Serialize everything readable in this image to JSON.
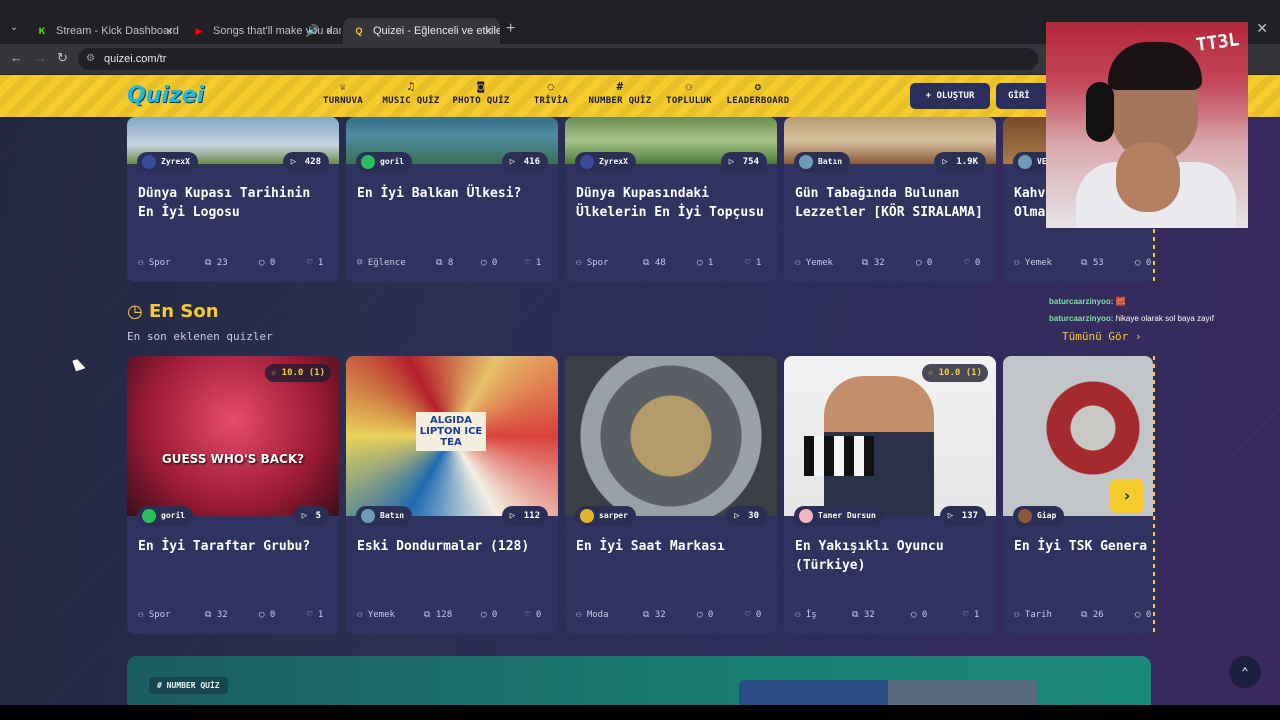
{
  "browser": {
    "tabs": [
      {
        "title": "Stream - Kick Dashboard",
        "fav": "K",
        "fav_color": "#53fc18"
      },
      {
        "title": "Songs that'll make you dan",
        "fav": "▶",
        "fav_color": "#ff0000"
      },
      {
        "title": "Quizei - Eğlenceli ve etkileşimli",
        "fav": "Q",
        "fav_color": "#f6cc2c"
      }
    ],
    "url": "quizei.com/tr"
  },
  "site": {
    "logo": "Quizei",
    "nav": [
      {
        "label": "TURNUVA",
        "icon": "trophy-icon"
      },
      {
        "label": "MUSIC QUİZ",
        "icon": "music-icon"
      },
      {
        "label": "PHOTO QUİZ",
        "icon": "camera-icon"
      },
      {
        "label": "TRİVİA",
        "icon": "chat-icon"
      },
      {
        "label": "NUMBER QUİZ",
        "icon": "hash-icon"
      },
      {
        "label": "TOPLULUK",
        "icon": "people-icon"
      },
      {
        "label": "LEADERBOARD",
        "icon": "medal-icon"
      }
    ],
    "create_label": "+ OLUŞTUR",
    "login_label": "GİRİ"
  },
  "top_cards": [
    {
      "author": "ZyrexX",
      "plays": "428",
      "title": "Dünya Kupası Tarihinin En İyi Logosu",
      "category": "Spor",
      "items": "23",
      "comments": "0",
      "likes": "1"
    },
    {
      "author": "goril",
      "plays": "416",
      "title": "En İyi Balkan Ülkesi?",
      "category": "Eğlence",
      "items": "8",
      "comments": "0",
      "likes": "1"
    },
    {
      "author": "ZyrexX",
      "plays": "754",
      "title": "Dünya Kupasındaki Ülkelerin En İyi Topçusu",
      "category": "Spor",
      "items": "48",
      "comments": "1",
      "likes": "1"
    },
    {
      "author": "Batın",
      "plays": "1.9K",
      "title": "Gün Tabağında Bulunan Lezzetler [KÖR SIRALAMA]",
      "category": "Yemek",
      "items": "32",
      "comments": "0",
      "likes": "0"
    },
    {
      "author": "VE",
      "plays": "",
      "title": "Kahv Olma",
      "category": "Yemek",
      "items": "53",
      "comments": "0",
      "likes": ""
    }
  ],
  "section": {
    "title": "En Son",
    "subtitle": "En son eklenen quizler",
    "see_all": "Tümünü Gör ›"
  },
  "latest_cards": [
    {
      "author": "goril",
      "plays": "5",
      "title": "En İyi Taraftar Grubu?",
      "category": "Spor",
      "items": "32",
      "comments": "0",
      "likes": "1",
      "rating": "☆ 10.0 (1)",
      "img_text": "GUESS WHO'S BACK?"
    },
    {
      "author": "Batın",
      "plays": "112",
      "title": "Eski Dondurmalar (128)",
      "category": "Yemek",
      "items": "128",
      "comments": "0",
      "likes": "0",
      "rating": "",
      "img_text": "ALGIDA LIPTON ICE TEA"
    },
    {
      "author": "sarper",
      "plays": "30",
      "title": "En İyi Saat Markası",
      "category": "Moda",
      "items": "32",
      "comments": "0",
      "likes": "0",
      "rating": "",
      "img_text": ""
    },
    {
      "author": "Taner Dursun",
      "plays": "137",
      "title": "En Yakışıklı Oyuncu (Türkiye)",
      "category": "İş",
      "items": "32",
      "comments": "0",
      "likes": "1",
      "rating": "☆ 10.0 (1)",
      "img_text": ""
    },
    {
      "author": "Giap",
      "plays": "",
      "title": "En İyi TSK Genera",
      "category": "Tarih",
      "items": "26",
      "comments": "0",
      "likes": "",
      "rating": "",
      "img_text": ""
    }
  ],
  "number_quiz_badge": "# NUMBER QUİZ",
  "chat": [
    {
      "user": "baturcaarzinyoo:",
      "msg": "🧱"
    },
    {
      "user": "baturcaarzinyoo:",
      "msg": "hikaye olarak sol baya zayıf"
    }
  ],
  "webcam_sign": "TT3L",
  "colors": {
    "accent": "#f6cc2c",
    "card": "#2f3360",
    "logo": "#1fb6e8"
  }
}
